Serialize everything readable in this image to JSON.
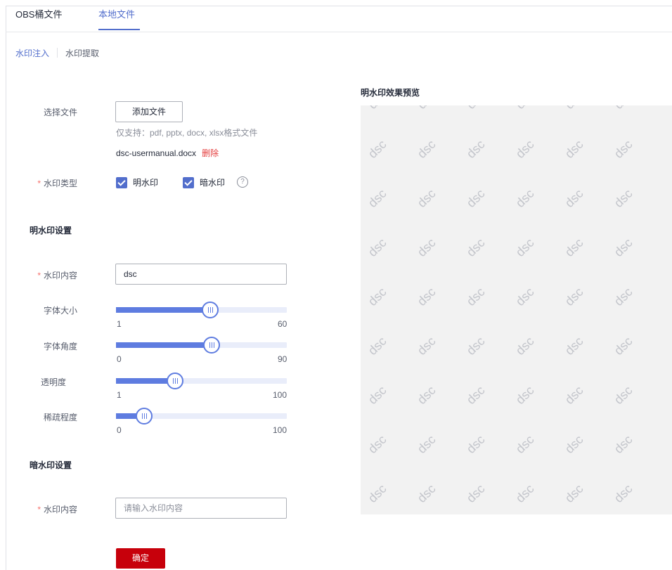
{
  "tabs": [
    {
      "label": "OBS桶文件",
      "active": false
    },
    {
      "label": "本地文件",
      "active": true
    }
  ],
  "subnav": {
    "inject": "水印注入",
    "extract": "水印提取"
  },
  "file": {
    "label": "选择文件",
    "add_button": "添加文件",
    "hint": "仅支持：pdf, pptx, docx, xlsx格式文件",
    "filename": "dsc-usermanual.docx",
    "delete": "删除"
  },
  "watermark_type": {
    "label": "水印类型",
    "visible": {
      "label": "明水印",
      "checked": true
    },
    "invisible": {
      "label": "暗水印",
      "checked": true
    },
    "help_icon": "question-circle-icon",
    "help_glyph": "?"
  },
  "visible_settings": {
    "title": "明水印设置",
    "content_label": "水印内容",
    "content_value": "dsc",
    "sliders": [
      {
        "label": "字体大小",
        "min": "1",
        "max": "60",
        "value": 35
      },
      {
        "label": "字体角度",
        "min": "0",
        "max": "90",
        "value": 55
      },
      {
        "label": "透明度",
        "min": "1",
        "max": "100",
        "value": 35
      },
      {
        "label": "稀疏程度",
        "min": "0",
        "max": "100",
        "value": 16
      }
    ]
  },
  "invisible_settings": {
    "title": "暗水印设置",
    "content_label": "水印内容",
    "content_placeholder": "请输入水印内容"
  },
  "confirm_button": "确定",
  "preview": {
    "title": "明水印效果预览",
    "watermark_text": "dsc"
  },
  "colors": {
    "accent": "#526ecc",
    "confirm": "#c7000b",
    "required": "#f66f6a",
    "delete": "#e43d3d"
  }
}
